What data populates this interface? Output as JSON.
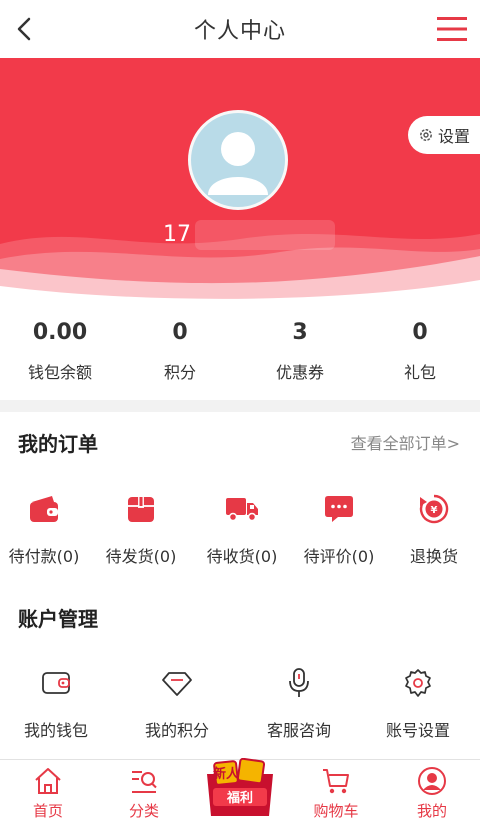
{
  "header": {
    "title": "个人中心"
  },
  "profile": {
    "settings_label": "设置",
    "username": "17"
  },
  "stats": [
    {
      "value": "0.00",
      "label": "钱包余额"
    },
    {
      "value": "0",
      "label": "积分"
    },
    {
      "value": "3",
      "label": "优惠券"
    },
    {
      "value": "0",
      "label": "礼包"
    }
  ],
  "orders": {
    "title": "我的订单",
    "view_all": "查看全部订单>",
    "items": [
      {
        "label": "待付款(0)",
        "icon": "wallet-icon"
      },
      {
        "label": "待发货(0)",
        "icon": "package-icon"
      },
      {
        "label": "待收货(0)",
        "icon": "truck-icon"
      },
      {
        "label": "待评价(0)",
        "icon": "comment-icon"
      },
      {
        "label": "退换货",
        "icon": "refund-icon"
      }
    ]
  },
  "account": {
    "title": "账户管理",
    "items": [
      {
        "label": "我的钱包",
        "icon": "wallet-outline-icon"
      },
      {
        "label": "我的积分",
        "icon": "diamond-icon"
      },
      {
        "label": "客服咨询",
        "icon": "microphone-icon"
      },
      {
        "label": "账号设置",
        "icon": "gear-icon"
      }
    ]
  },
  "tabbar": {
    "items": [
      {
        "label": "首页",
        "icon": "home-icon"
      },
      {
        "label": "分类",
        "icon": "category-search-icon"
      },
      {
        "label": "",
        "icon": "newcomer-promo-icon"
      },
      {
        "label": "购物车",
        "icon": "cart-icon"
      },
      {
        "label": "我的",
        "icon": "user-icon"
      }
    ],
    "promo_line1": "新人",
    "promo_line2": "福利"
  },
  "colors": {
    "accent": "#f23a4a",
    "text": "#333333",
    "muted": "#888888"
  }
}
